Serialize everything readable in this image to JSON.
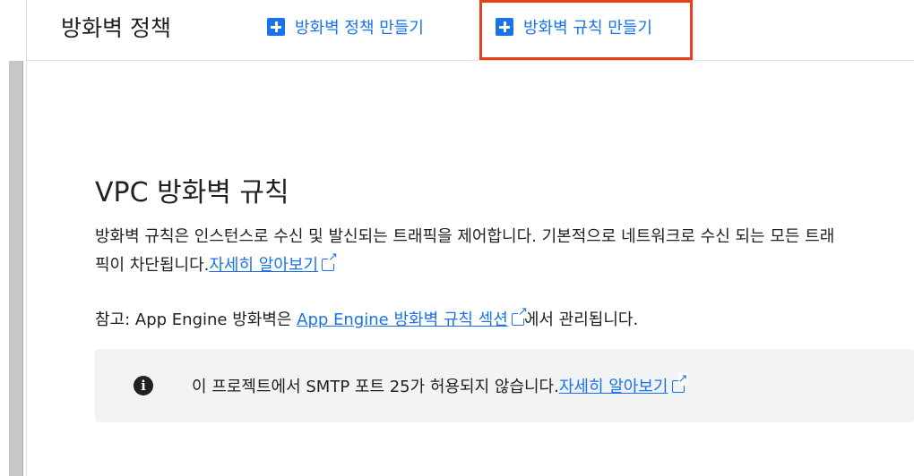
{
  "header": {
    "title": "방화벽 정책",
    "create_policy_label": "방화벽 정책 만들기",
    "create_rule_label": "방화벽 규칙 만들기"
  },
  "section": {
    "title": "VPC 방화벽 규칙",
    "description": "방화벽 규칙은 인스턴스로 수신 및 발신되는 트래픽을 제어합니다. 기본적으로 네트워크로 수신 되는 모든 트래픽이 차단됩니다.",
    "learn_more": "자세히 알아보기",
    "note_prefix": "참고: App Engine 방화벽은 ",
    "note_link": "App Engine 방화벽 규칙 섹션",
    "note_suffix": "에서 관리됩니다."
  },
  "info_box": {
    "text": "이 프로젝트에서 SMTP 포트 25가 허용되지 않습니다.",
    "learn_more": "자세히 알아보기"
  },
  "colors": {
    "accent": "#1a73e8",
    "highlight": "#e8401c",
    "info_bg": "#f1f3f4"
  },
  "icons": [
    "plus-icon",
    "external-link-icon",
    "info-icon"
  ]
}
